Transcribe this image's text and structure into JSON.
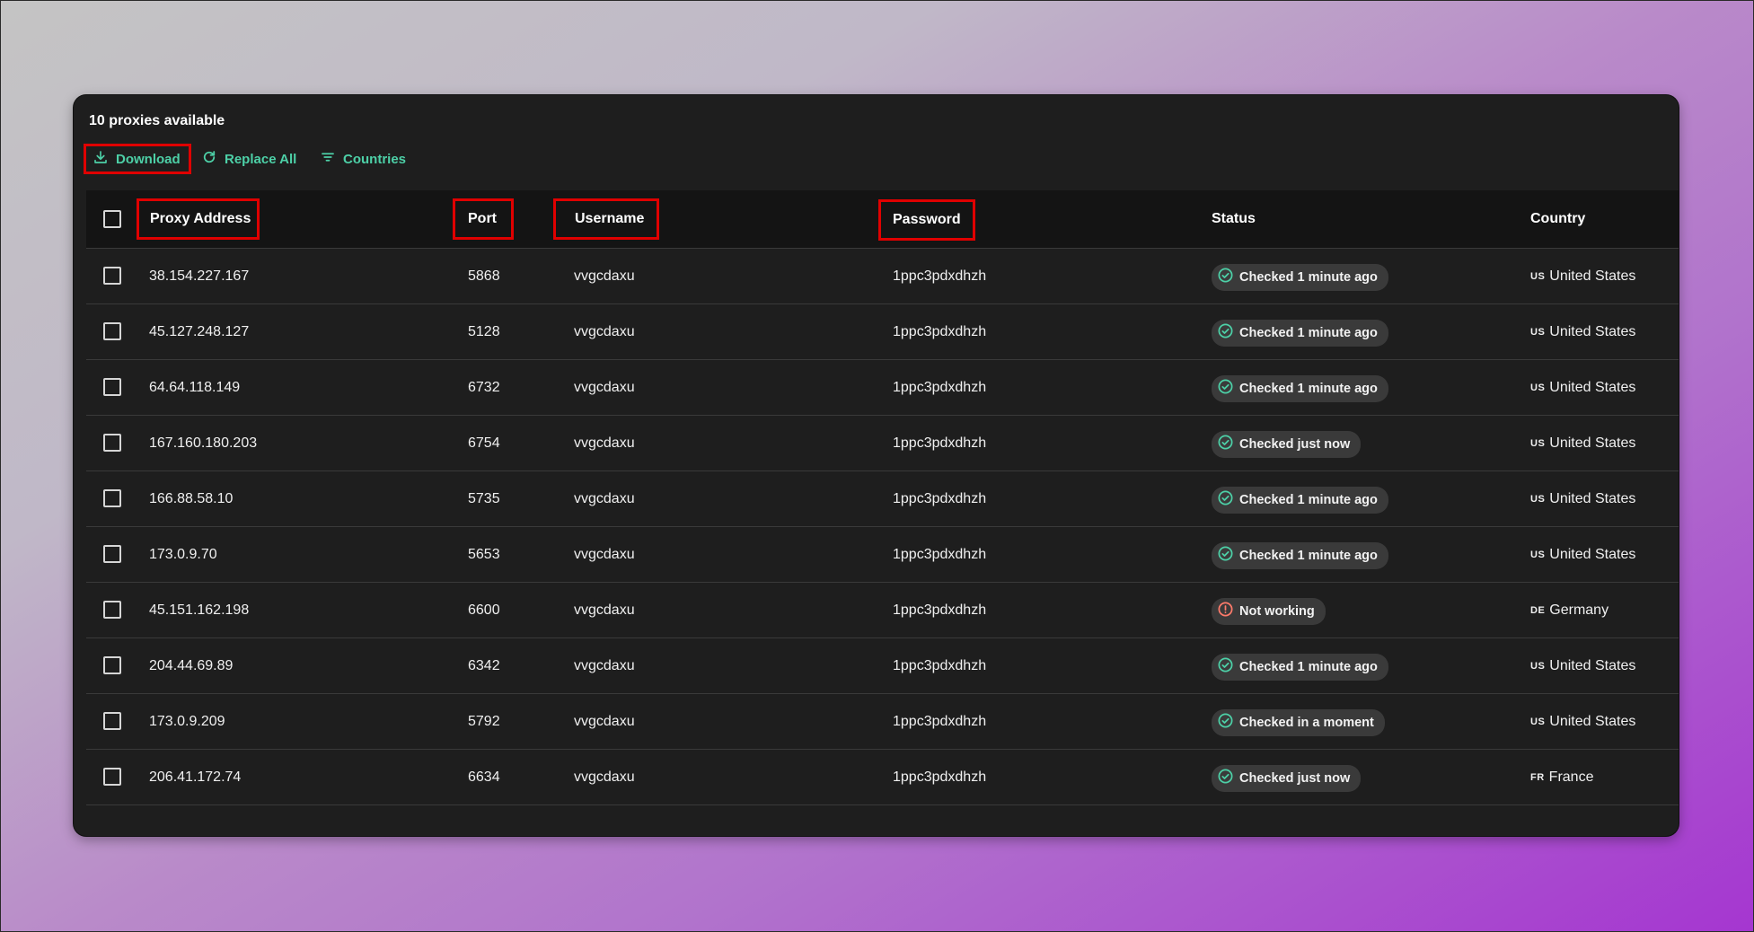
{
  "header": {
    "title": "10 proxies available"
  },
  "toolbar": {
    "download_label": "Download",
    "replace_all_label": "Replace All",
    "countries_label": "Countries"
  },
  "icons": {
    "download": "download-icon",
    "replace": "refresh-icon",
    "countries": "filter-icon",
    "ok": "check-circle-icon",
    "error": "alert-circle-icon"
  },
  "colors": {
    "accent": "#4dd0a7",
    "highlight": "#e00000",
    "ok": "#4dd0a7",
    "error": "#ff7b6b"
  },
  "columns": {
    "proxy": "Proxy Address",
    "port": "Port",
    "username": "Username",
    "password": "Password",
    "status": "Status",
    "country": "Country"
  },
  "rows": [
    {
      "proxy": "38.154.227.167",
      "port": "5868",
      "username": "vvgcdaxu",
      "password": "1ppc3pdxdhzh",
      "status": "Checked 1 minute ago",
      "ok": true,
      "code": "US",
      "country": "United States"
    },
    {
      "proxy": "45.127.248.127",
      "port": "5128",
      "username": "vvgcdaxu",
      "password": "1ppc3pdxdhzh",
      "status": "Checked 1 minute ago",
      "ok": true,
      "code": "US",
      "country": "United States"
    },
    {
      "proxy": "64.64.118.149",
      "port": "6732",
      "username": "vvgcdaxu",
      "password": "1ppc3pdxdhzh",
      "status": "Checked 1 minute ago",
      "ok": true,
      "code": "US",
      "country": "United States"
    },
    {
      "proxy": "167.160.180.203",
      "port": "6754",
      "username": "vvgcdaxu",
      "password": "1ppc3pdxdhzh",
      "status": "Checked just now",
      "ok": true,
      "code": "US",
      "country": "United States"
    },
    {
      "proxy": "166.88.58.10",
      "port": "5735",
      "username": "vvgcdaxu",
      "password": "1ppc3pdxdhzh",
      "status": "Checked 1 minute ago",
      "ok": true,
      "code": "US",
      "country": "United States"
    },
    {
      "proxy": "173.0.9.70",
      "port": "5653",
      "username": "vvgcdaxu",
      "password": "1ppc3pdxdhzh",
      "status": "Checked 1 minute ago",
      "ok": true,
      "code": "US",
      "country": "United States"
    },
    {
      "proxy": "45.151.162.198",
      "port": "6600",
      "username": "vvgcdaxu",
      "password": "1ppc3pdxdhzh",
      "status": "Not working",
      "ok": false,
      "code": "DE",
      "country": "Germany"
    },
    {
      "proxy": "204.44.69.89",
      "port": "6342",
      "username": "vvgcdaxu",
      "password": "1ppc3pdxdhzh",
      "status": "Checked 1 minute ago",
      "ok": true,
      "code": "US",
      "country": "United States"
    },
    {
      "proxy": "173.0.9.209",
      "port": "5792",
      "username": "vvgcdaxu",
      "password": "1ppc3pdxdhzh",
      "status": "Checked in a moment",
      "ok": true,
      "code": "US",
      "country": "United States"
    },
    {
      "proxy": "206.41.172.74",
      "port": "6634",
      "username": "vvgcdaxu",
      "password": "1ppc3pdxdhzh",
      "status": "Checked just now",
      "ok": true,
      "code": "FR",
      "country": "France"
    }
  ]
}
